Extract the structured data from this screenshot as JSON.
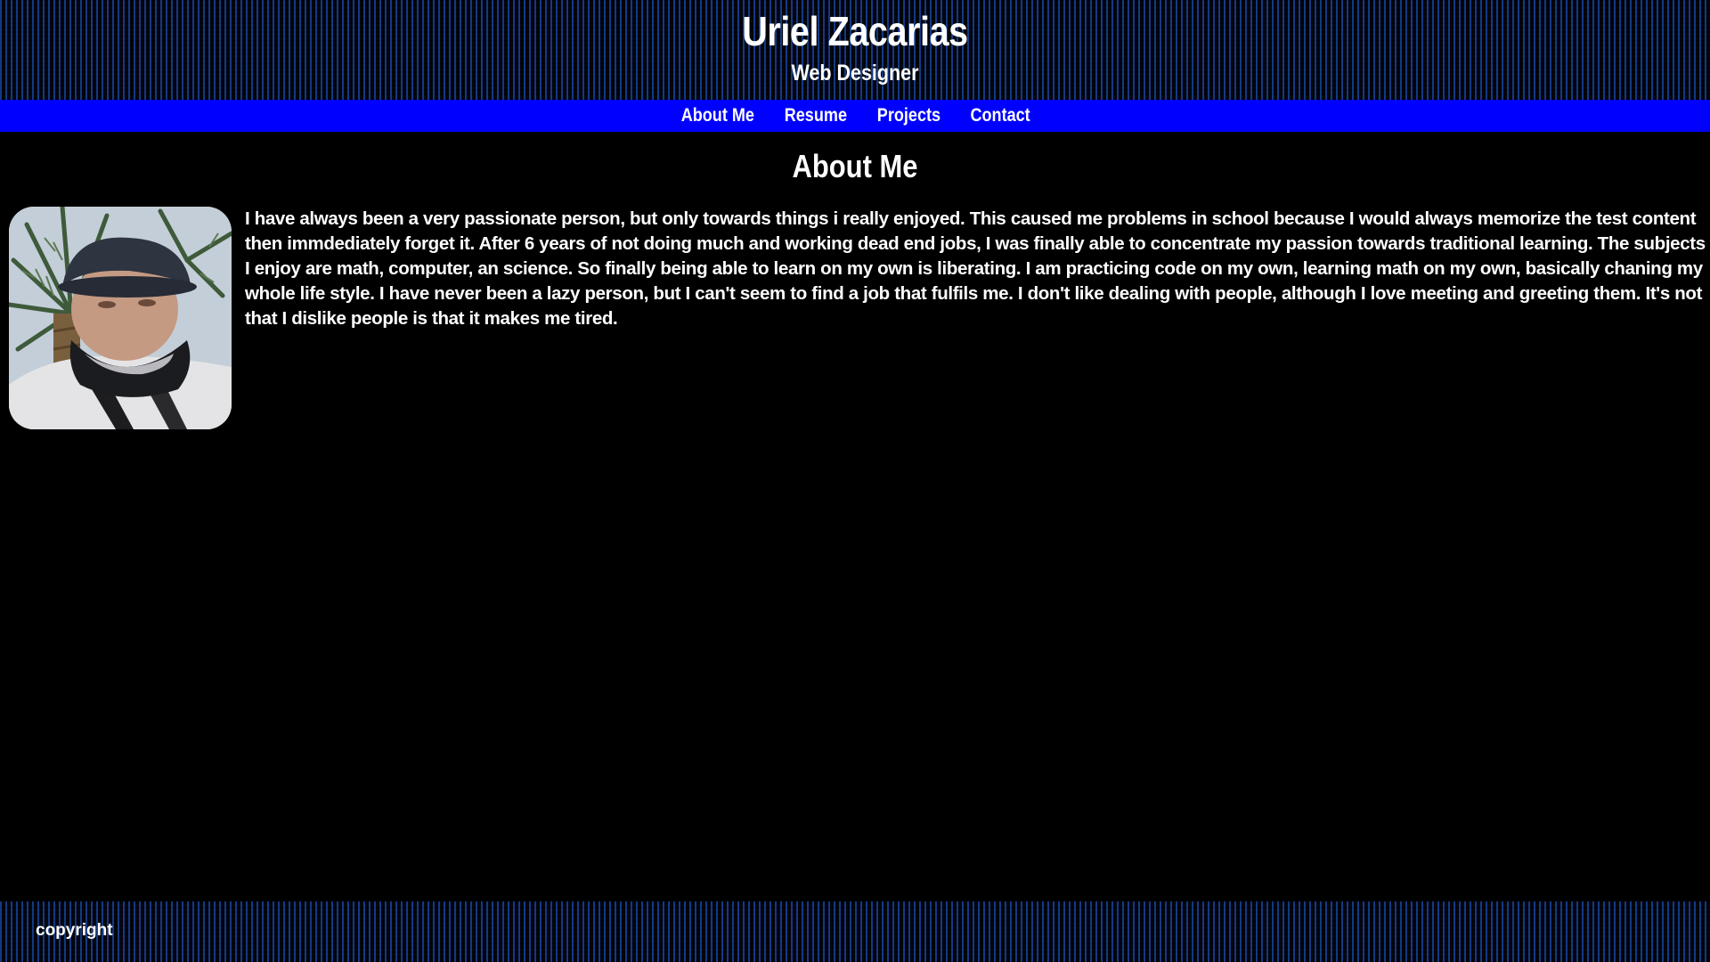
{
  "header": {
    "title": "Uriel Zacarias",
    "subtitle": "Web Designer"
  },
  "nav": {
    "items": [
      {
        "label": "About Me"
      },
      {
        "label": "Resume"
      },
      {
        "label": "Projects"
      },
      {
        "label": "Contact"
      }
    ]
  },
  "main": {
    "section_title": "About Me",
    "avatar_icon": "profile-photo",
    "bio": "I have always been a very passionate person, but only towards things i really enjoyed. This caused me problems in school because I would always memorize the test content then immdediately forget it. After 6 years of not doing much and working dead end jobs, I was finally able to concentrate my passion towards traditional learning. The subjects I enjoy are math, computer, an science. So finally being able to learn on my own is liberating. I am practicing code on my own, learning math on my own, basically chaning my whole life style. I have never been a lazy person, but I can't seem to find a job that fulfils me. I don't like dealing with people, although I love meeting and greeting them. It's not that I dislike people is that it makes me tired."
  },
  "footer": {
    "copyright": "copyright"
  },
  "colors": {
    "background": "#000000",
    "nav_bar": "#0000ff",
    "pattern_accent": "#143c8c",
    "text": "#ffffff"
  }
}
